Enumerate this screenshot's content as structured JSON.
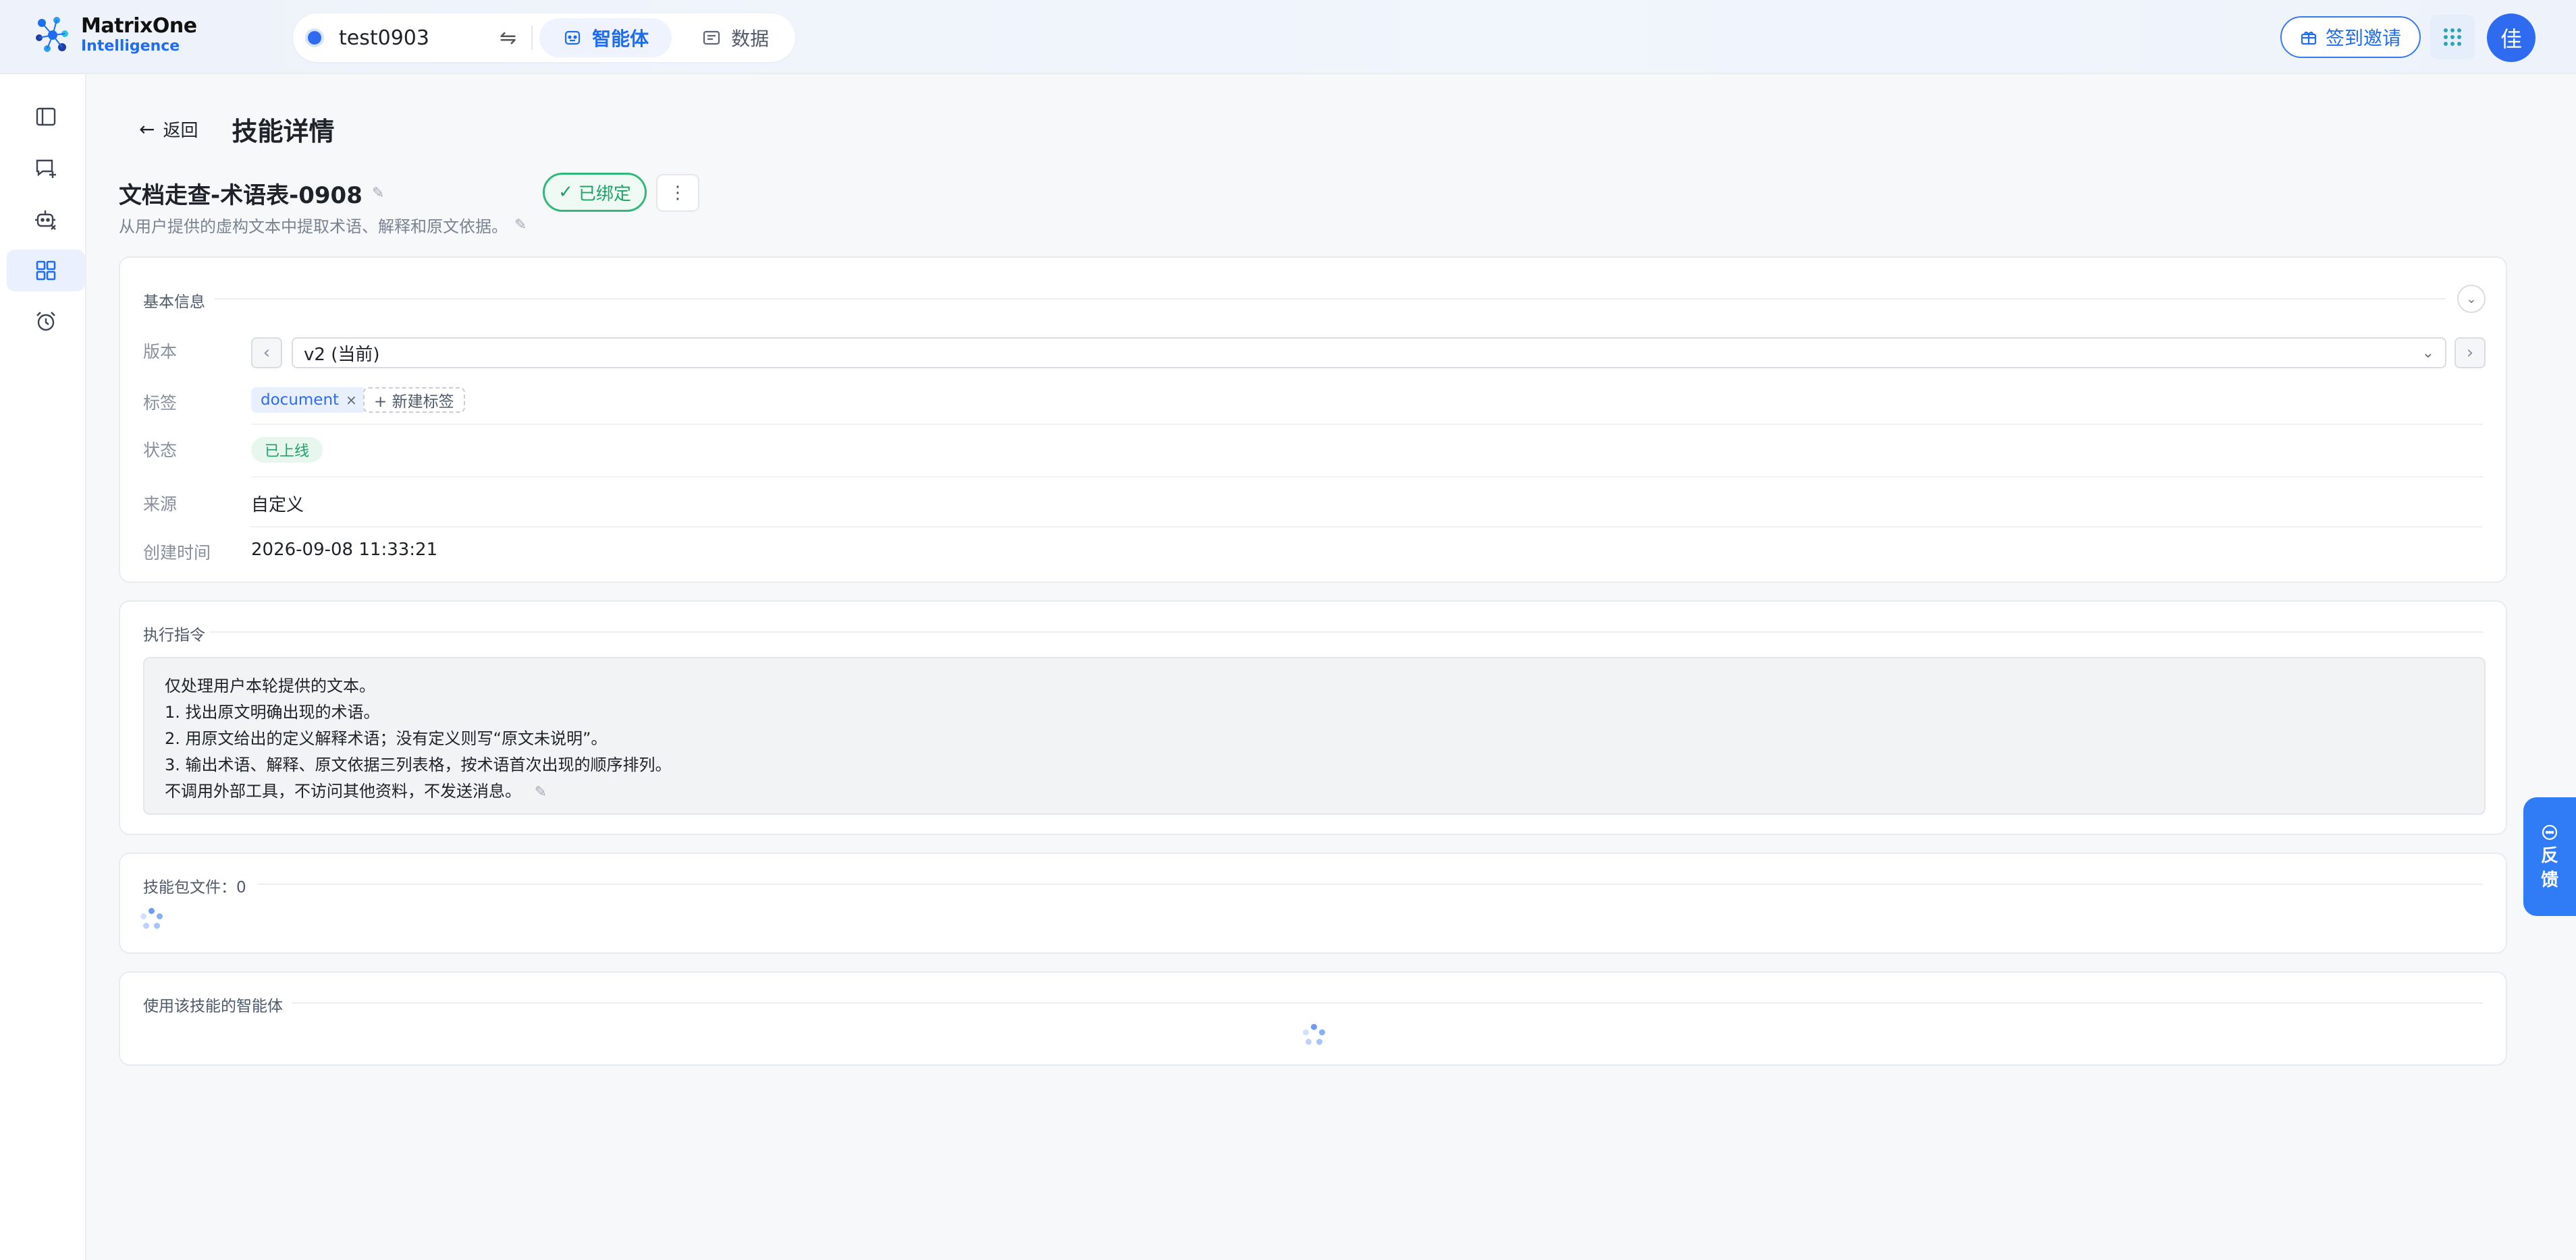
{
  "brand": {
    "line1": "MatrixOne",
    "line2": "Intelligence"
  },
  "workspace": {
    "name": "test0903",
    "tabs": [
      {
        "label": "智能体",
        "icon": "robot-icon",
        "active": true
      },
      {
        "label": "数据",
        "icon": "data-icon",
        "active": false
      }
    ]
  },
  "header": {
    "invite_label": "签到邀请",
    "avatar_text": "佳"
  },
  "sidebar": {
    "items": [
      {
        "icon": "sidebar-toggle-icon"
      },
      {
        "icon": "new-chat-icon"
      },
      {
        "icon": "agent-icon"
      },
      {
        "icon": "skills-grid-icon",
        "active": true
      },
      {
        "icon": "alarm-clock-icon"
      }
    ]
  },
  "page": {
    "back_label": "返回",
    "title": "技能详情"
  },
  "skill": {
    "name": "文档走查-术语表-0908",
    "description": "从用户提供的虚构文本中提取术语、解释和原文依据。",
    "bound_label": "已绑定"
  },
  "basic_info": {
    "section_title": "基本信息",
    "version_label": "版本",
    "version_value": "v2 (当前)",
    "tags_label": "标签",
    "tags": [
      "document"
    ],
    "new_tag_label": "+ 新建标签",
    "status_label": "状态",
    "status_value": "已上线",
    "source_label": "来源",
    "source_value": "自定义",
    "created_label": "创建时间",
    "created_value": "2026-09-08 11:33:21"
  },
  "instructions": {
    "section_title": "执行指令",
    "lines": [
      "仅处理用户本轮提供的文本。",
      "1. 找出原文明确出现的术语。",
      "2. 用原文给出的定义解释术语；没有定义则写“原文未说明”。",
      "3. 输出术语、解释、原文依据三列表格，按术语首次出现的顺序排列。",
      "不调用外部工具，不访问其他资料，不发送消息。"
    ]
  },
  "package_files": {
    "section_title": "技能包文件：0"
  },
  "agents_using": {
    "section_title": "使用该技能的智能体"
  },
  "feedback": {
    "label": [
      "反",
      "馈"
    ]
  },
  "colors": {
    "accent": "#1e6cf0",
    "success": "#1ea266",
    "background": "#f7f8fa"
  }
}
